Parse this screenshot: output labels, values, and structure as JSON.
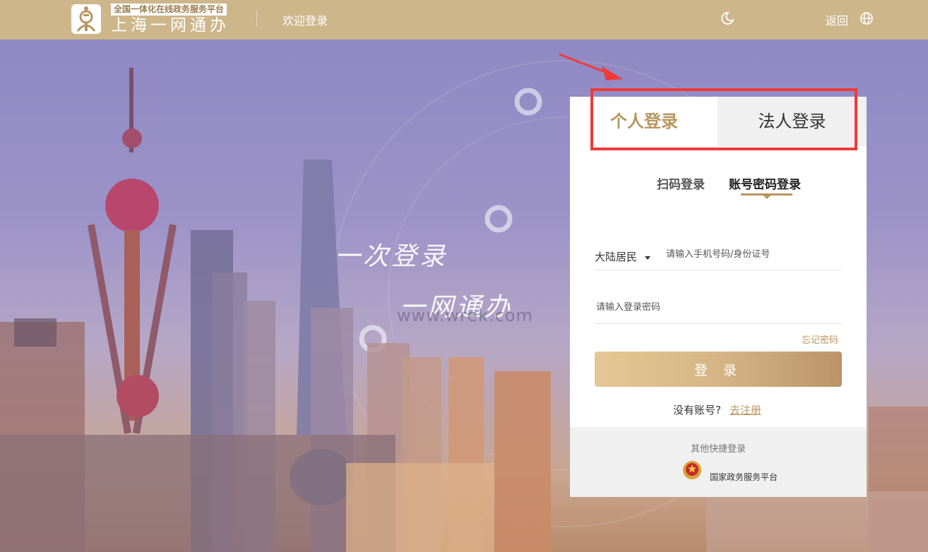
{
  "header": {
    "logo_subtitle": "全国一体化在线政务服务平台",
    "logo_title": "上海一网通办",
    "welcome": "欢迎登录",
    "back": "返回",
    "bg_color": "#cdb68a"
  },
  "hero": {
    "slogan_line1": "一次登录",
    "slogan_line2": "一网通办",
    "watermark": "www.wrek.com"
  },
  "login": {
    "tabs": [
      {
        "label": "个人登录",
        "active": true
      },
      {
        "label": "法人登录",
        "active": false
      }
    ],
    "subtabs": [
      {
        "label": "扫码登录",
        "active": false
      },
      {
        "label": "账号密码登录",
        "active": true
      }
    ],
    "resident_select": "大陆居民",
    "phone_placeholder": "请输入手机号码/身份证号",
    "password_placeholder": "请输入登录密码",
    "forgot": "忘记密码",
    "login_button": "登 录",
    "no_account": "没有账号?",
    "register": "去注册",
    "quick_title": "其他快捷登录",
    "national_platform": "国家政务服务平台",
    "accent_color": "#b99560",
    "highlight_color": "#f03a3a"
  }
}
